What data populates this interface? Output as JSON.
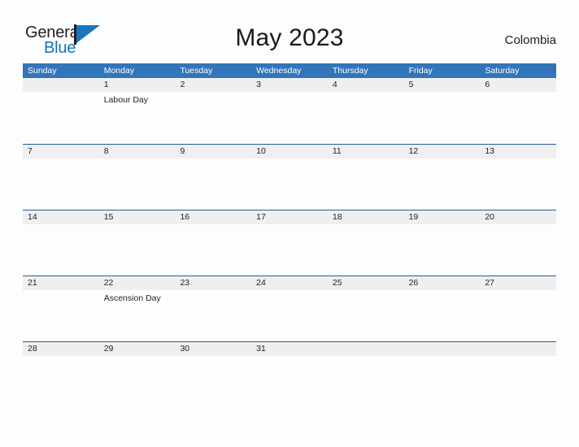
{
  "brand": {
    "name_part1": "General",
    "name_part2": "Blue",
    "mark_icon": "triangle-flag-icon",
    "accent_color": "#1b75bc"
  },
  "header": {
    "title": "May 2023",
    "region": "Colombia"
  },
  "colors": {
    "header_blue": "#3275b8",
    "row_divider_blue": "#1f5d9e",
    "date_band_gray": "#efefef",
    "text_dark": "#222222",
    "page_background": "#fdfdfd"
  },
  "calendar": {
    "weekdays": [
      "Sunday",
      "Monday",
      "Tuesday",
      "Wednesday",
      "Thursday",
      "Friday",
      "Saturday"
    ],
    "weeks": [
      {
        "dates": [
          "",
          "1",
          "2",
          "3",
          "4",
          "5",
          "6"
        ],
        "events": [
          "",
          "Labour Day",
          "",
          "",
          "",
          "",
          ""
        ]
      },
      {
        "dates": [
          "7",
          "8",
          "9",
          "10",
          "11",
          "12",
          "13"
        ],
        "events": [
          "",
          "",
          "",
          "",
          "",
          "",
          ""
        ]
      },
      {
        "dates": [
          "14",
          "15",
          "16",
          "17",
          "18",
          "19",
          "20"
        ],
        "events": [
          "",
          "",
          "",
          "",
          "",
          "",
          ""
        ]
      },
      {
        "dates": [
          "21",
          "22",
          "23",
          "24",
          "25",
          "26",
          "27"
        ],
        "events": [
          "",
          "Ascension Day",
          "",
          "",
          "",
          "",
          ""
        ]
      },
      {
        "dates": [
          "28",
          "29",
          "30",
          "31",
          "",
          "",
          ""
        ],
        "events": [
          "",
          "",
          "",
          "",
          "",
          "",
          ""
        ]
      }
    ]
  }
}
